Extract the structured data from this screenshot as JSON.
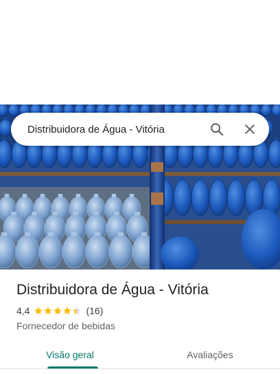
{
  "search": {
    "query": "Distribuidora de Água - Vitória",
    "search_icon": "search-icon",
    "close_icon": "close-icon"
  },
  "photo": {
    "subject": "water-jugs-photo"
  },
  "place": {
    "name": "Distribuidora de Água - Vitória",
    "rating": "4,4",
    "rating_value": 4.4,
    "review_count": "(16)",
    "category": "Fornecedor de bebidas"
  },
  "tabs": [
    {
      "label": "Visão geral",
      "active": true
    },
    {
      "label": "Avaliações",
      "active": false
    }
  ],
  "colors": {
    "accent": "#00796b",
    "star": "#fbbc04",
    "star_empty": "#dadce0",
    "text_primary": "#202124",
    "text_secondary": "#5f6368"
  }
}
